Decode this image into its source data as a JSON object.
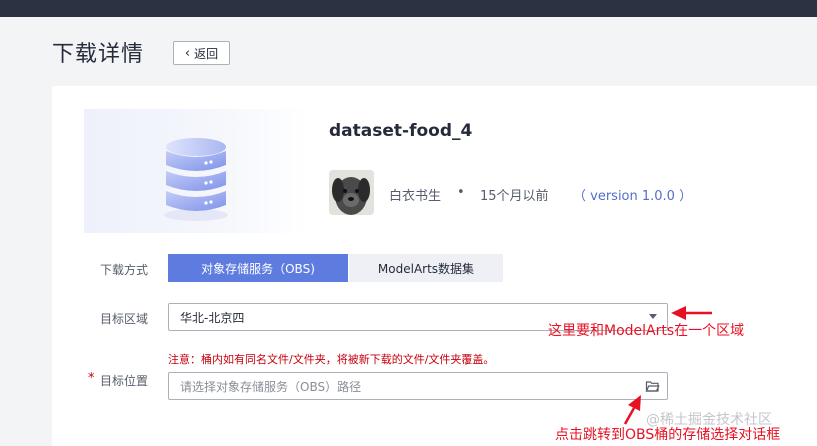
{
  "header": {
    "page_title": "下载详情",
    "back_label": "返回"
  },
  "dataset": {
    "title": "dataset-food_4",
    "author": "白衣书生",
    "separator": "•",
    "time": "15个月以前",
    "version": "（ version 1.0.0 ）"
  },
  "form": {
    "download_method_label": "下载方式",
    "method_options": [
      "对象存储服务（OBS)",
      "ModelArts数据集"
    ],
    "selected_method": "对象存储服务（OBS)",
    "target_region_label": "目标区域",
    "region_value": "华北-北京四",
    "notice": "注意：桶内如有同名文件/文件夹，将被新下载的文件/文件夹覆盖。",
    "required_mark": "*",
    "target_location_label": "目标位置",
    "location_placeholder": "请选择对象存储服务（OBS）路径"
  },
  "annotations": {
    "region_note": "这里要和ModelArts在一个区域",
    "folder_note": "点击跳转到OBS桶的存储选择对话框"
  },
  "watermark": "@稀土掘金技术社区",
  "colors": {
    "accent": "#5e7ce0",
    "annotation_red": "#e81123",
    "topbar": "#2d3242",
    "warning_text": "#c7000b"
  },
  "icons": {
    "back": "chevron-left-icon",
    "dropdown": "caret-down-icon",
    "folder": "folder-open-icon",
    "dataset": "database-icon"
  }
}
